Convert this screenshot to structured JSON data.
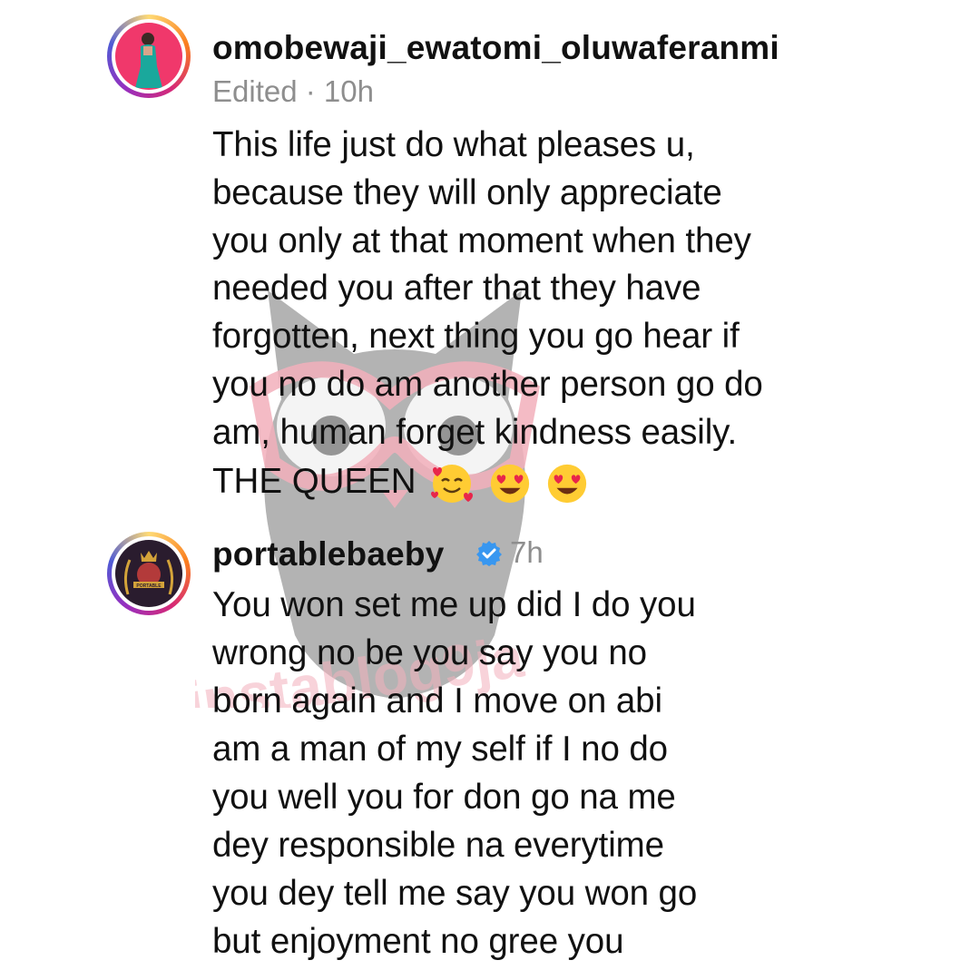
{
  "watermark": {
    "text": "instablog9ja"
  },
  "comments": [
    {
      "username": "omobewaji_ewatomi_oluwaferanmi",
      "edited": "Edited",
      "separator": "·",
      "time": "10h",
      "text": "This life just do what pleases u,\nbecause they will only appreciate\nyou only at that moment when they\nneeded you after that they have\nforgotten, next thing you go hear if\nyou no do am another person go do\nam, human forget kindness easily.",
      "signoff": "THE QUEEN",
      "emojis": [
        "smiling-face-with-hearts",
        "heart-eyes",
        "heart-eyes"
      ]
    },
    {
      "username": "portablebaeby",
      "verified": true,
      "time": "7h",
      "text": "You won set me up did I do you\nwrong no be you say you no\nborn again and I move on abi\nam a man of my self if I no do\nyou well you for don go na me\ndey responsible na everytime\nyou dey tell me say you won go\nbut enjoyment no gree you",
      "avatar_label": "PORTABLE"
    }
  ],
  "colors": {
    "username": "#111111",
    "meta": "#8e8e8e",
    "verified": "#3897f0",
    "watermark_pink": "#f1a7b4",
    "watermark_gray": "#8f8f8f"
  }
}
